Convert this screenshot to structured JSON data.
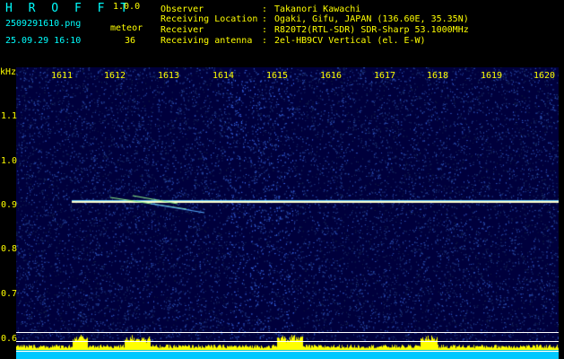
{
  "header": {
    "title": "H R O F F T",
    "version": "1.0.0",
    "filename": "2509291610.png",
    "datetime": "25.09.29 16:10",
    "meteor_label": "meteor",
    "meteor_count": "36"
  },
  "info": [
    {
      "key": "Observer",
      "value": "Takanori Kawachi"
    },
    {
      "key": "Receiving Location",
      "value": "Ogaki, Gifu, JAPAN (136.60E, 35.35N)"
    },
    {
      "key": "Receiver",
      "value": "R820T2(RTL-SDR) SDR-Sharp 53.1000MHz"
    },
    {
      "key": "Receiving antenna",
      "value": "2el-HB9CV Vertical (el. E-W)"
    }
  ],
  "axis": {
    "y_unit": "kHz",
    "time_ticks": [
      "1611",
      "1612",
      "1613",
      "1614",
      "1615",
      "1616",
      "1617",
      "1618",
      "1619",
      "1620"
    ],
    "freq_ticks": [
      "1.1",
      "1.0",
      "0.9",
      "0.8",
      "0.7",
      "0.6"
    ]
  },
  "colors": {
    "label": "#ffff00",
    "title": "#00ffff",
    "background": "#00003c",
    "carrier": "#ffffcc",
    "noise_floor": "#00c8ff",
    "noise_peak": "#ffff00"
  }
}
